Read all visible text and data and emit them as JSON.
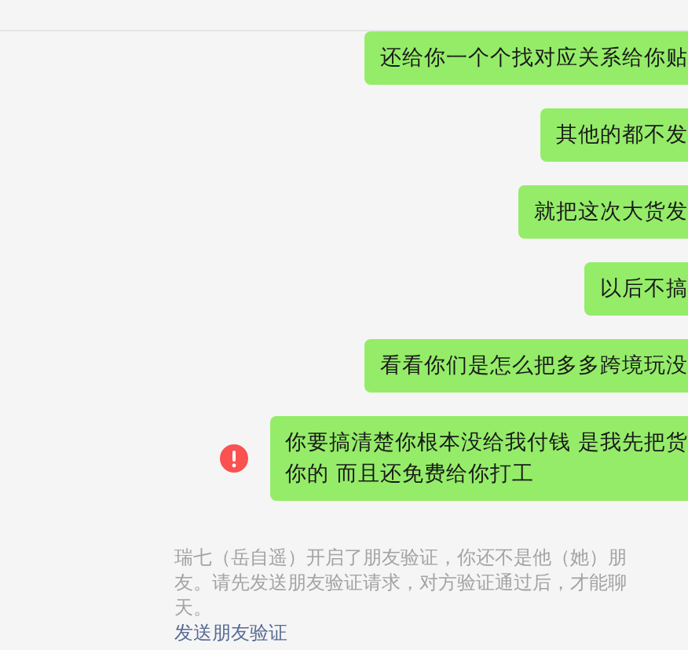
{
  "messages": [
    {
      "lines": [
        "还给你一个个找对应关系给你贴"
      ],
      "failed": false
    },
    {
      "lines": [
        "其他的都不发"
      ],
      "failed": false
    },
    {
      "lines": [
        "就把这次大货发"
      ],
      "failed": false
    },
    {
      "lines": [
        "以后不搞"
      ],
      "failed": false
    },
    {
      "lines": [
        "看看你们是怎么把多多跨境玩没"
      ],
      "failed": false
    },
    {
      "lines": [
        "你要搞清楚你根本没给我付钱 是我先把货",
        "你的 而且还免费给你打工"
      ],
      "failed": true
    }
  ],
  "notice": {
    "text": "瑞七（岳自遥）开启了朋友验证，你还不是他（她）朋友。请先发送朋友验证请求，对方验证通过后，才能聊天。",
    "link": "发送朋友验证"
  }
}
